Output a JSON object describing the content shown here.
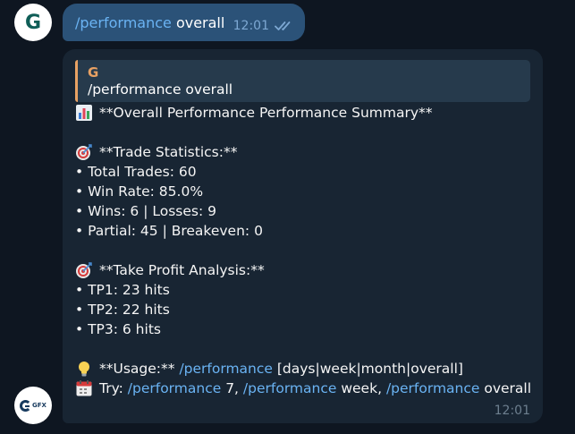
{
  "outgoing": {
    "avatar_letter": "G",
    "command": "/performance",
    "argument": " overall",
    "time": "12:01",
    "status_icon": "double-check-icon"
  },
  "incoming": {
    "bot_logo_text": "GFX",
    "reply": {
      "name": "G",
      "text": "/performance overall"
    },
    "title": "**Overall Performance Performance Summary**",
    "title_icon": "bar-chart-icon",
    "trade_stats": {
      "icon": "target-icon",
      "heading": "**Trade Statistics:**",
      "items": [
        "• Total Trades: 60",
        "• Win Rate: 85.0%",
        "• Wins: 6 | Losses: 9",
        "• Partial: 45 | Breakeven: 0"
      ]
    },
    "tp_analysis": {
      "icon": "target-icon",
      "heading": "**Take Profit Analysis:**",
      "items": [
        "• TP1: 23 hits",
        "• TP2: 22 hits",
        "• TP3: 6 hits"
      ]
    },
    "usage": {
      "icon": "lightbulb-icon",
      "prefix": "**Usage:** ",
      "command": "/performance",
      "args": " [days|week|month|overall]"
    },
    "try": {
      "icon": "calendar-icon",
      "prefix": "Try: ",
      "cmd1": "/performance",
      "arg1": " 7, ",
      "cmd2": "/performance",
      "arg2": " week, ",
      "cmd3": "/performance",
      "arg3": " overall"
    },
    "time": "12:01"
  },
  "colors": {
    "background": "#0e1621",
    "outgoing_bubble": "#2b5278",
    "incoming_bubble": "#182533",
    "link": "#6ab3f3",
    "reply_accent": "#e8a163"
  }
}
